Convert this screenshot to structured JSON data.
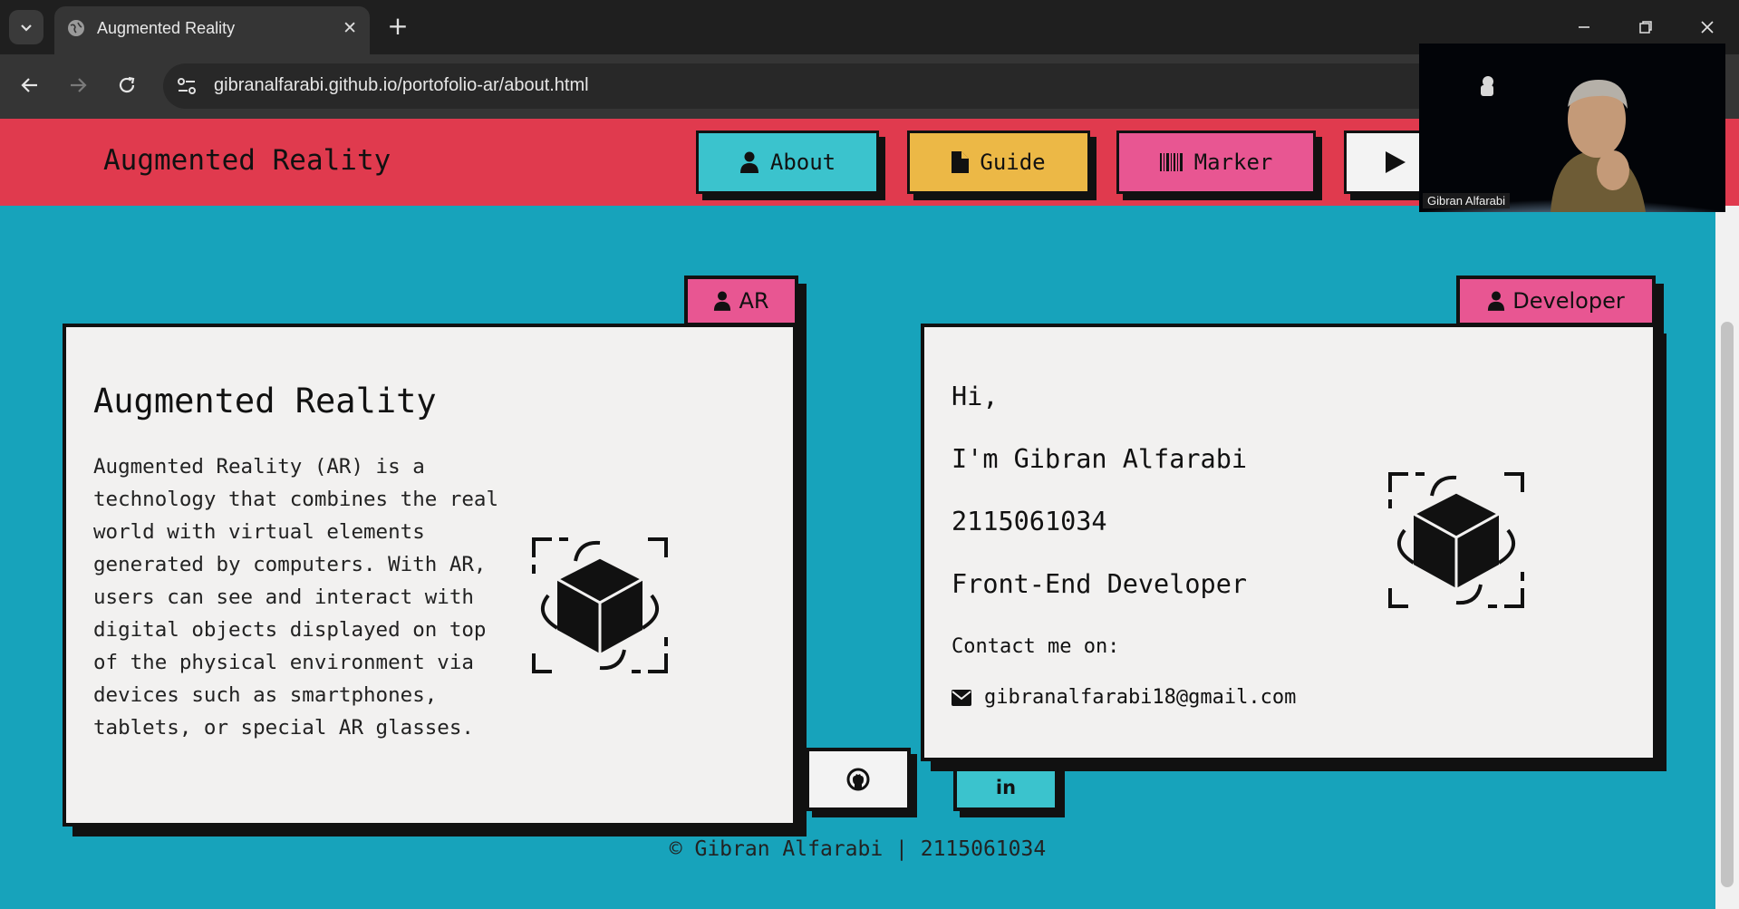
{
  "browser": {
    "tab_title": "Augmented Reality",
    "tab_close": "✕",
    "new_tab": "+",
    "url": "gibranalfarabi.github.io/portofolio-ar/about.html"
  },
  "header": {
    "brand": "Augmented Reality",
    "nav": {
      "about": "About",
      "guide": "Guide",
      "marker": "Marker"
    }
  },
  "ar_card": {
    "tag": "AR",
    "title": "Augmented Reality",
    "description": "Augmented Reality (AR) is a technology that combines the real world with virtual elements generated by computers. With AR, users can see and interact with digital objects displayed on top of the physical environment via devices such as smartphones, tablets, or special AR glasses."
  },
  "developer_card": {
    "tag": "Developer",
    "greeting": "Hi,",
    "name": "I'm Gibran Alfarabi",
    "nim": "2115061034",
    "role": "Front-End Developer",
    "contact_label": "Contact me on:",
    "email": "gibranalfarabi18@gmail.com"
  },
  "social": {
    "linkedin": "in"
  },
  "footer": "© Gibran Alfarabi | 2115061034",
  "webcam": {
    "participant_name": "Gibran Alfarabi"
  },
  "colors": {
    "page_bg": "#17a3bb",
    "header_bg": "#e03a4e",
    "about_btn": "#3bc3cd",
    "guide_btn": "#ecb846",
    "marker_btn": "#e85692",
    "card_bg": "#f2f1f0"
  },
  "icons": [
    "chevron-down-icon",
    "globe-icon",
    "close-icon",
    "plus-icon",
    "minimize-icon",
    "restore-icon",
    "back-arrow-icon",
    "forward-arrow-icon",
    "reload-icon",
    "site-settings-icon",
    "user-icon",
    "file-icon",
    "barcode-icon",
    "play-icon",
    "ar-cube-icon",
    "envelope-icon",
    "github-icon",
    "linkedin-icon"
  ]
}
